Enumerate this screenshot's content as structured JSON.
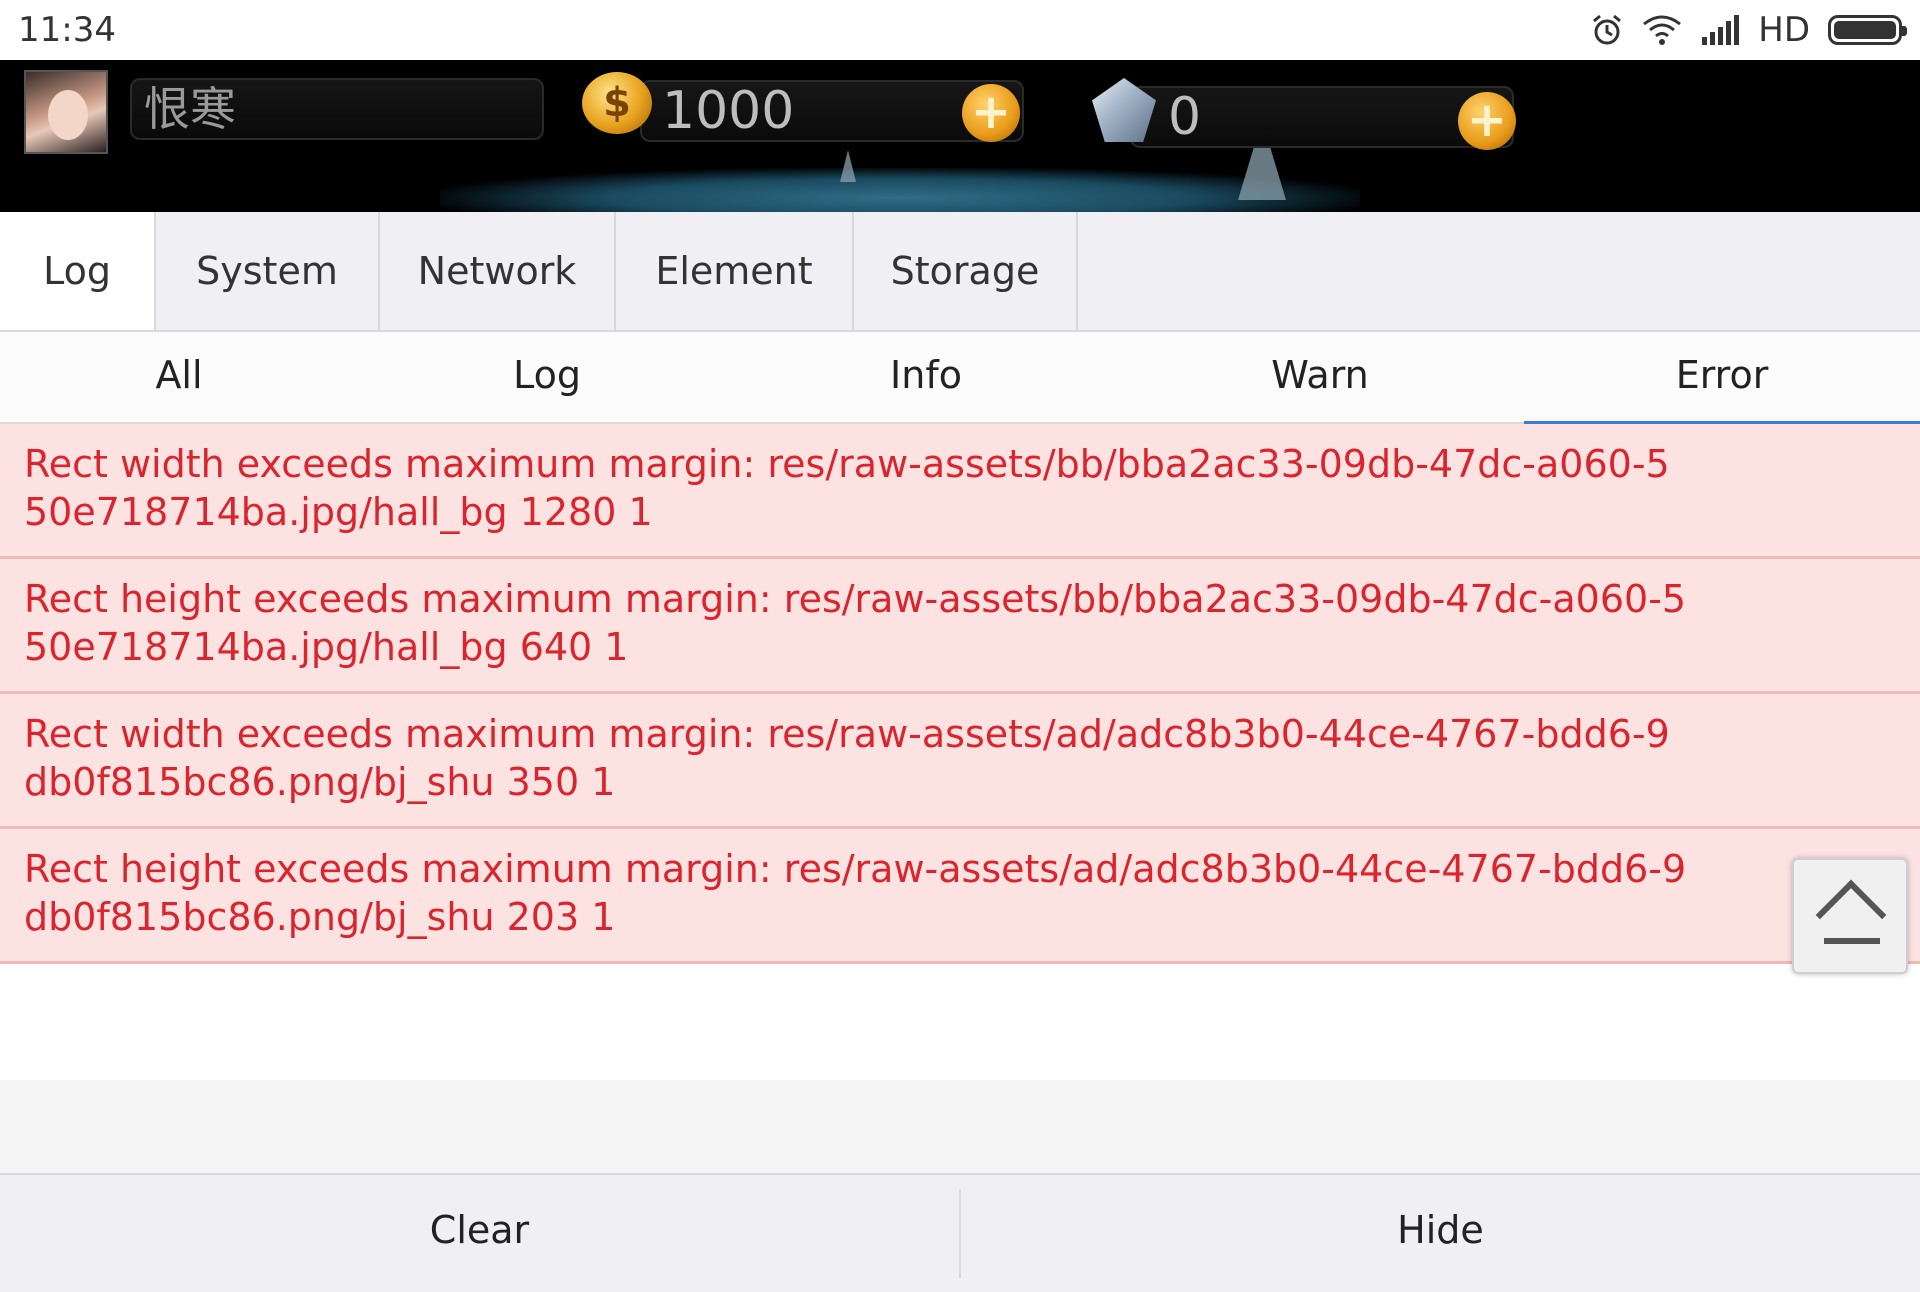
{
  "status_bar": {
    "time": "11:34",
    "network_label": "HD",
    "icons": [
      "alarm-icon",
      "wifi-icon",
      "signal-icon",
      "battery-icon"
    ]
  },
  "game_header": {
    "player_name": "恨寒",
    "coins": "1000",
    "gems": "0",
    "coin_symbol": "$",
    "plus_symbol": "+"
  },
  "tabs": [
    {
      "label": "Log",
      "active": true
    },
    {
      "label": "System",
      "active": false
    },
    {
      "label": "Network",
      "active": false
    },
    {
      "label": "Element",
      "active": false
    },
    {
      "label": "Storage",
      "active": false
    }
  ],
  "subtabs": [
    {
      "label": "All",
      "active": false
    },
    {
      "label": "Log",
      "active": false
    },
    {
      "label": "Info",
      "active": false
    },
    {
      "label": "Warn",
      "active": false
    },
    {
      "label": "Error",
      "active": true
    }
  ],
  "logs": [
    {
      "level": "error",
      "text": "Rect width exceeds maximum margin: res/raw-assets/bb/bba2ac33-09db-47dc-a060-550e718714ba.jpg/hall_bg 1280 1"
    },
    {
      "level": "error",
      "text": "Rect height exceeds maximum margin: res/raw-assets/bb/bba2ac33-09db-47dc-a060-550e718714ba.jpg/hall_bg 640 1"
    },
    {
      "level": "error",
      "text": "Rect width exceeds maximum margin: res/raw-assets/ad/adc8b3b0-44ce-4767-bdd6-9db0f815bc86.png/bj_shu 350 1"
    },
    {
      "level": "error",
      "text": "Rect height exceeds maximum margin: res/raw-assets/ad/adc8b3b0-44ce-4767-bdd6-9db0f815bc86.png/bj_shu 203 1"
    }
  ],
  "footer": {
    "clear_label": "Clear",
    "hide_label": "Hide"
  },
  "colors": {
    "error_text": "#d9262e",
    "error_bg": "#fde2e2",
    "active_underline": "#3a7bd5"
  }
}
